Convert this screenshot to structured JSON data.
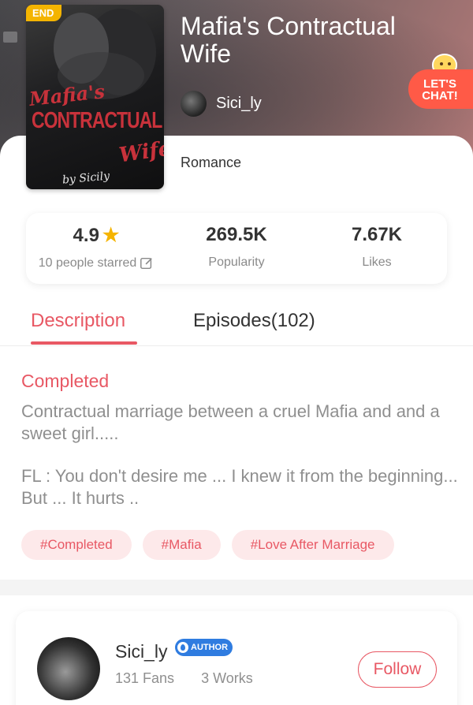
{
  "book": {
    "badge": "END",
    "title": "Mafia's Contractual Wife",
    "author": "Sici_ly",
    "genre": "Romance",
    "cover": {
      "line1": "Mafia's",
      "line2": "CONTRACTUAL",
      "line3": "Wife",
      "byline": "by Sicily"
    }
  },
  "chat_button": {
    "label": "LET'S CHAT!"
  },
  "stats": {
    "rating": {
      "value": "4.9",
      "label": "10 people starred"
    },
    "popularity": {
      "value": "269.5K",
      "label": "Popularity"
    },
    "likes": {
      "value": "7.67K",
      "label": "Likes"
    }
  },
  "tabs": {
    "description": "Description",
    "episodes": "Episodes(102)"
  },
  "description": {
    "status": "Completed",
    "paragraph1": "Contractual marriage between a cruel Mafia and and a sweet girl.....",
    "paragraph2": "FL : You don't desire me ... I knew it from the beginning... But ... It hurts .."
  },
  "tags": [
    "#Completed",
    "#Mafia",
    "#Love After Marriage"
  ],
  "author_card": {
    "name": "Sici_ly",
    "badge": "AUTHOR",
    "fans": "131 Fans",
    "works": "3 Works",
    "follow_label": "Follow"
  },
  "colors": {
    "accent": "#e85864",
    "badge_yellow": "#f4b400",
    "chat_orange": "#ff5a47",
    "author_blue": "#2f7ce0"
  }
}
